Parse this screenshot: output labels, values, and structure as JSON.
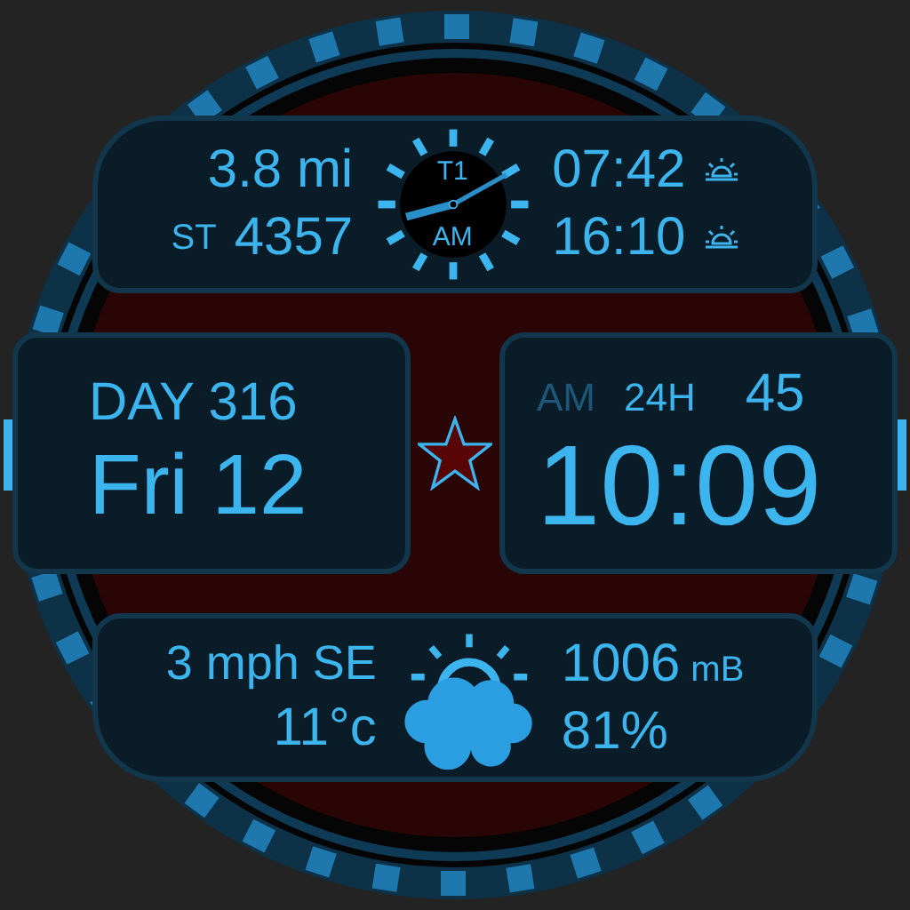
{
  "activity": {
    "distance": "3.8 mi",
    "steps_label": "ST",
    "steps": "4357"
  },
  "mini_clock": {
    "top_label": "T1",
    "bottom_label": "AM"
  },
  "sun": {
    "sunrise": "07:42",
    "sunset": "16:10"
  },
  "date": {
    "day_of_year": "DAY 316",
    "date": "Fri 12"
  },
  "time": {
    "am": {
      "label": "AM",
      "active": false
    },
    "format": "24H",
    "seconds": "45",
    "time": "10:09"
  },
  "weather": {
    "wind": "3 mph SE",
    "temperature": "11°c",
    "pressure": "1006",
    "pressure_unit": "mB",
    "humidity": "81%"
  }
}
